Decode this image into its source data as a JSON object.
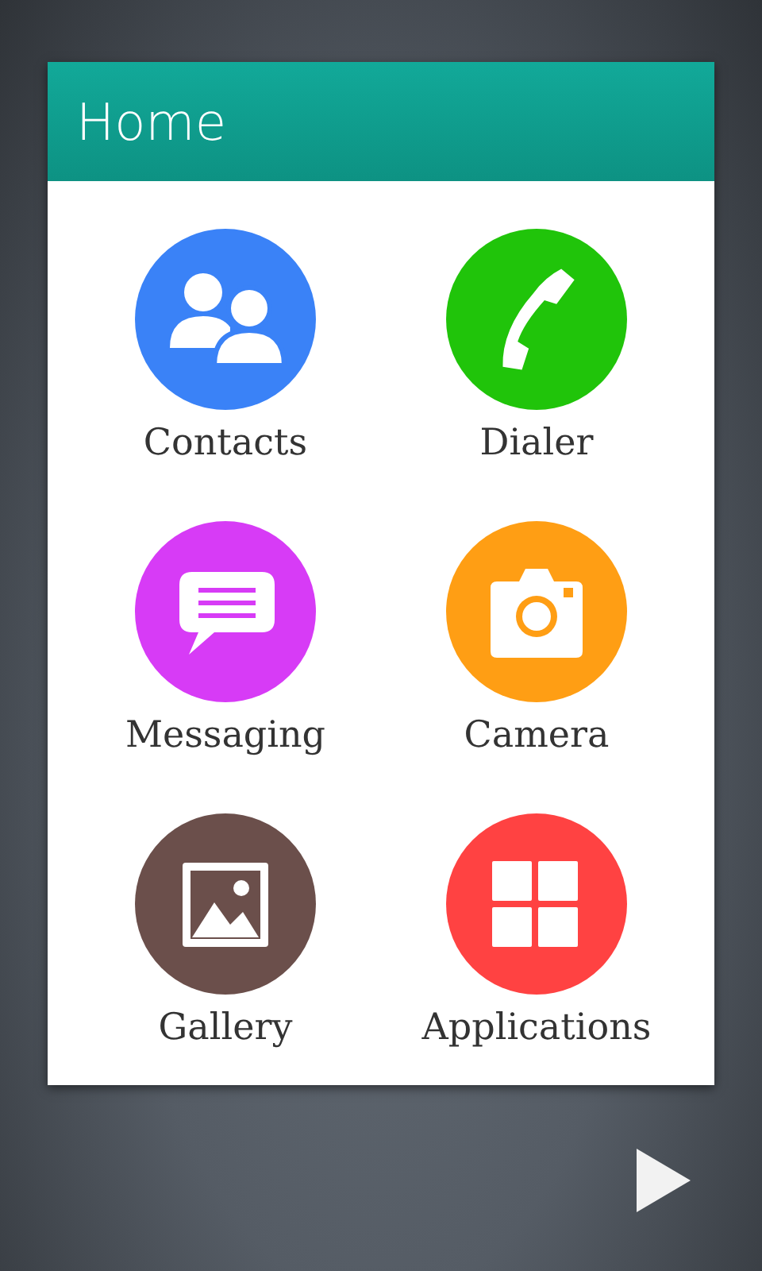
{
  "header": {
    "title": "Home"
  },
  "apps": [
    {
      "label": "Contacts",
      "color": "#3a82f7"
    },
    {
      "label": "Dialer",
      "color": "#20c40a"
    },
    {
      "label": "Messaging",
      "color": "#d73bf6"
    },
    {
      "label": "Camera",
      "color": "#ff9e14"
    },
    {
      "label": "Gallery",
      "color": "#6b4f4b"
    },
    {
      "label": "Applications",
      "color": "#ff4242"
    }
  ]
}
